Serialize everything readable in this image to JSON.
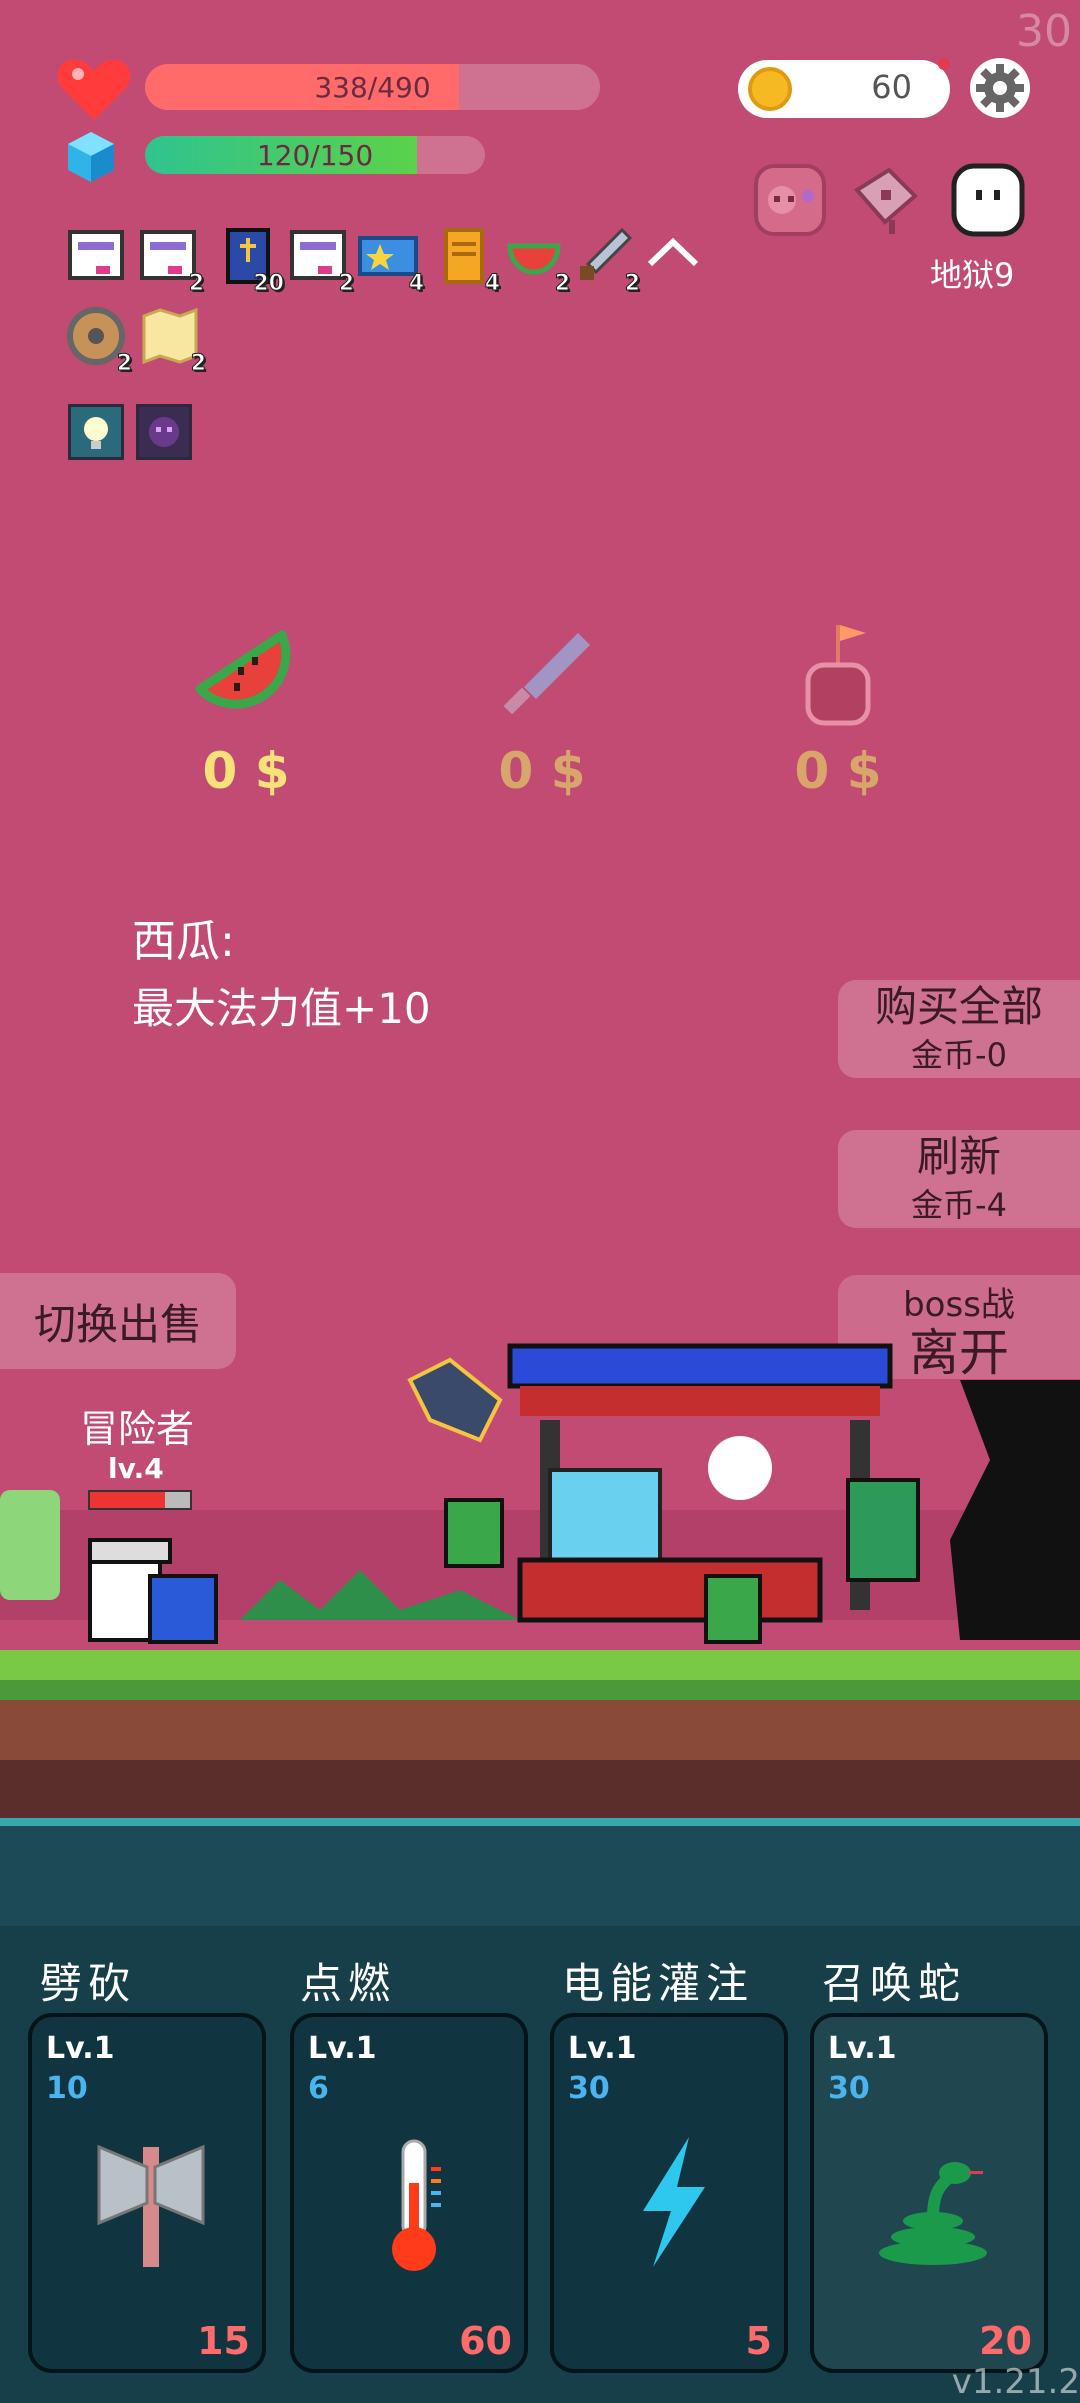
{
  "fps": "30",
  "player": {
    "hp_text": "338/490",
    "hp_fraction": 0.69,
    "mp_text": "120/150",
    "mp_fraction": 0.8
  },
  "coins": "60",
  "level_name": "地狱9",
  "inventory_row1": [
    {
      "icon": "scroll-paper-icon",
      "count": ""
    },
    {
      "icon": "scroll-paper-icon",
      "count": "2"
    },
    {
      "icon": "holy-book-icon",
      "count": "20"
    },
    {
      "icon": "scroll-paper-icon",
      "count": "2"
    },
    {
      "icon": "star-card-icon",
      "count": "4"
    },
    {
      "icon": "golden-scroll-icon",
      "count": "4"
    },
    {
      "icon": "watermelon-icon",
      "count": "2"
    },
    {
      "icon": "sword-icon",
      "count": "2"
    }
  ],
  "inventory_row2": [
    {
      "icon": "round-shield-icon",
      "count": "2"
    },
    {
      "icon": "map-icon",
      "count": "2"
    }
  ],
  "shop": {
    "items": [
      {
        "icon": "watermelon-icon",
        "price": "0 $"
      },
      {
        "icon": "knife-icon",
        "price": "0 $"
      },
      {
        "icon": "potion-flag-icon",
        "price": "0 $"
      }
    ],
    "selected_title": "西瓜:",
    "selected_desc": "最大法力值+10",
    "buy_all": "购买全部",
    "buy_all_cost": "金币-0",
    "refresh": "刷新",
    "refresh_cost": "金币-4",
    "leave_sub": "boss战",
    "leave": "离开",
    "toggle_sell": "切换出售"
  },
  "adventurer": {
    "name": "冒险者",
    "level": "lv.4",
    "hp_fraction": 0.75
  },
  "skills": [
    {
      "name": "劈砍",
      "lv": "Lv.1",
      "cost": "10",
      "dmg": "15",
      "icon": "axe-icon"
    },
    {
      "name": "点燃",
      "lv": "Lv.1",
      "cost": "6",
      "dmg": "60",
      "icon": "thermometer-icon"
    },
    {
      "name": "电能灌注",
      "lv": "Lv.1",
      "cost": "30",
      "dmg": "5",
      "icon": "lightning-icon"
    },
    {
      "name": "召唤蛇",
      "lv": "Lv.1",
      "cost": "30",
      "dmg": "20",
      "icon": "snake-icon"
    }
  ],
  "version": "v1.21.2",
  "colors": {
    "background": "#c24b74",
    "hp": "#ff6b6b",
    "mp": "#5bd24a",
    "price_active": "#f7e27a",
    "price_inactive": "#d8a56a"
  }
}
